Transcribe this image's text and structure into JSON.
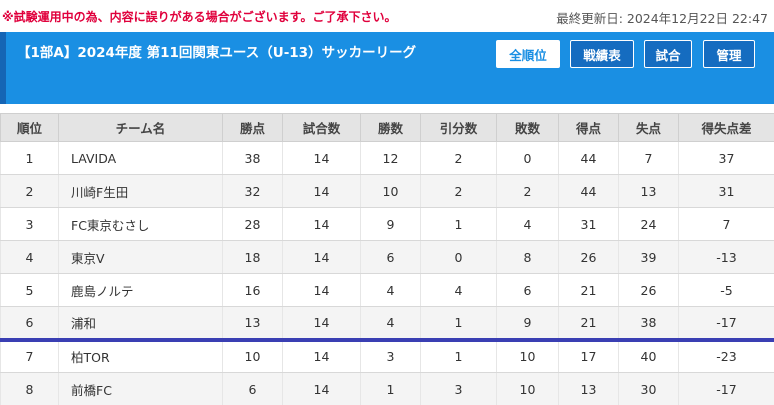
{
  "notice": "※試験運用中の為、内容に誤りがある場合がございます。ご了承下さい。",
  "updated": "最終更新日: 2024年12月22日 22:47",
  "header": {
    "title": "【1部A】2024年度 第11回関東ユース（U-13）サッカーリーグ",
    "buttons": {
      "standings": "全順位",
      "results": "戦績表",
      "matches": "試合",
      "admin": "管理"
    }
  },
  "colors": {
    "header": "#1a8fe3",
    "notice": "#e0003c",
    "cutoff_line": "#3a3fb3"
  },
  "table": {
    "headers": [
      "順位",
      "チーム名",
      "勝点",
      "試合数",
      "勝数",
      "引分数",
      "敗数",
      "得点",
      "失点",
      "得失点差"
    ],
    "rows": [
      [
        "1",
        "LAVIDA",
        "38",
        "14",
        "12",
        "2",
        "0",
        "44",
        "7",
        "37"
      ],
      [
        "2",
        "川崎F生田",
        "32",
        "14",
        "10",
        "2",
        "2",
        "44",
        "13",
        "31"
      ],
      [
        "3",
        "FC東京むさし",
        "28",
        "14",
        "9",
        "1",
        "4",
        "31",
        "24",
        "7"
      ],
      [
        "4",
        "東京V",
        "18",
        "14",
        "6",
        "0",
        "8",
        "26",
        "39",
        "-13"
      ],
      [
        "5",
        "鹿島ノルテ",
        "16",
        "14",
        "4",
        "4",
        "6",
        "21",
        "26",
        "-5"
      ],
      [
        "6",
        "浦和",
        "13",
        "14",
        "4",
        "1",
        "9",
        "21",
        "38",
        "-17"
      ],
      [
        "7",
        "柏TOR",
        "10",
        "14",
        "3",
        "1",
        "10",
        "17",
        "40",
        "-23"
      ],
      [
        "8",
        "前橋FC",
        "6",
        "14",
        "1",
        "3",
        "10",
        "13",
        "30",
        "-17"
      ]
    ]
  }
}
